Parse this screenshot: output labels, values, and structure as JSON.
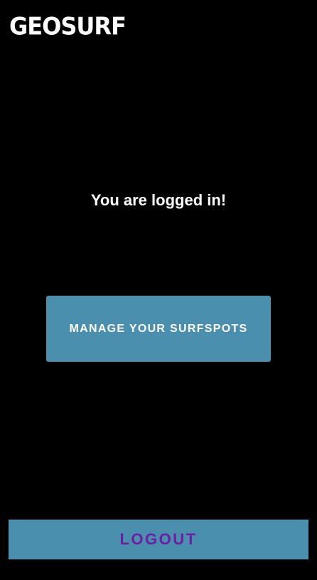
{
  "app": {
    "logo_text": "GEOSURF"
  },
  "main": {
    "status_text": "You are logged in!",
    "manage_button_label": "MANAGE YOUR SURFSPOTS"
  },
  "footer": {
    "logout_button_label": "LOGOUT"
  },
  "colors": {
    "background": "#000000",
    "button_bg": "#4b8fae",
    "button_text": "#ffffff",
    "logout_text": "#6b1fa3"
  }
}
